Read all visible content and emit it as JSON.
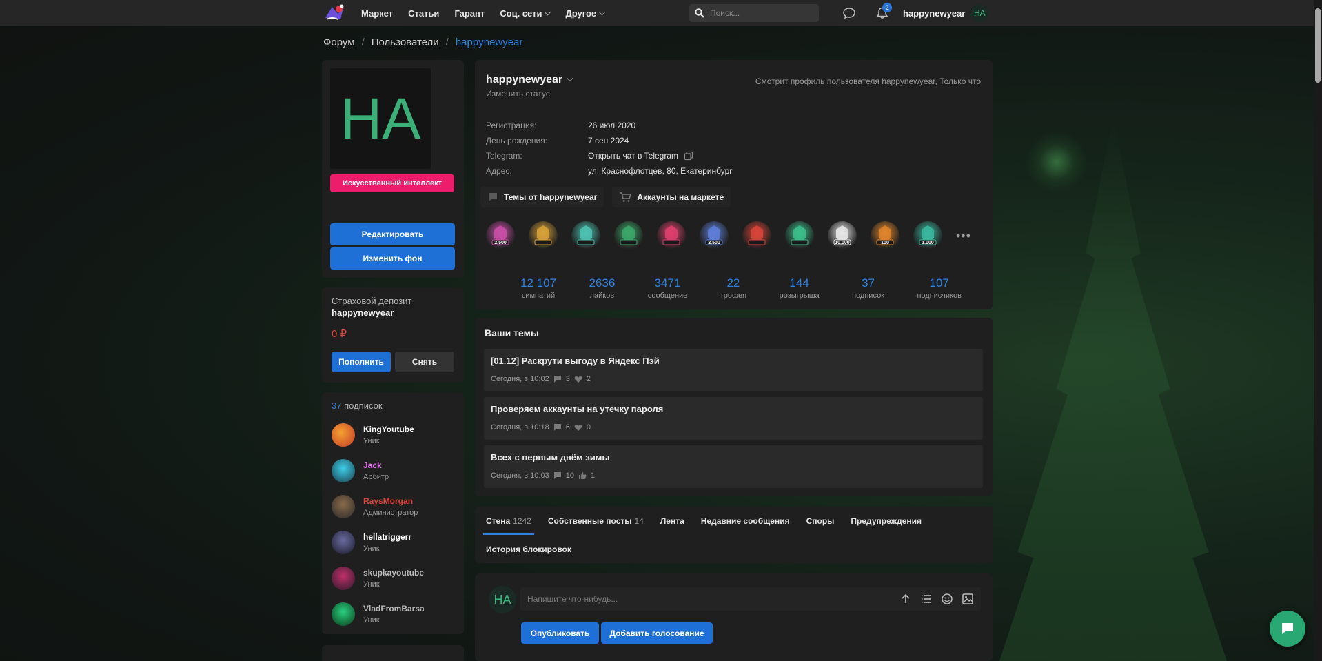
{
  "topbar": {
    "nav": [
      {
        "label": "Маркет",
        "dropdown": false
      },
      {
        "label": "Статьи",
        "dropdown": false
      },
      {
        "label": "Гарант",
        "dropdown": false
      },
      {
        "label": "Соц. сети",
        "dropdown": true
      },
      {
        "label": "Другое",
        "dropdown": true
      }
    ],
    "search_placeholder": "Поиск...",
    "notification_count": "2",
    "username": "happynewyear",
    "avatar_initials": "HA"
  },
  "breadcrumb": {
    "items": [
      "Форум",
      "Пользователи"
    ],
    "current": "happynewyear"
  },
  "profile_card": {
    "avatar_initials": "HA",
    "badge": "Искусственный интеллект",
    "edit_label": "Редактировать",
    "change_bg_label": "Изменить фон"
  },
  "deposit": {
    "title": "Страховой депозит",
    "username": "happynewyear",
    "amount": "0 ₽",
    "topup_label": "Пополнить",
    "withdraw_label": "Снять"
  },
  "subscriptions": {
    "count": "37",
    "label": "подписок",
    "items": [
      {
        "name": "KingYoutube",
        "role": "Уник",
        "color": "#ffffff",
        "strike": false
      },
      {
        "name": "Jack",
        "role": "Арбитр",
        "color": "#e277f0",
        "strike": false
      },
      {
        "name": "RaysMorgan",
        "role": "Администратор",
        "color": "#e0443a",
        "strike": false
      },
      {
        "name": "hellatriggerr",
        "role": "Уник",
        "color": "#ffffff",
        "strike": false
      },
      {
        "name": "skupkayoutube",
        "role": "Уник",
        "color": "#b8b8b8",
        "strike": true
      },
      {
        "name": "VladFromBarsa",
        "role": "Уник",
        "color": "#b8b8b8",
        "strike": true
      }
    ]
  },
  "profile": {
    "username": "happynewyear",
    "change_status": "Изменить статус",
    "viewing_note": "Смотрит профиль пользователя happynewyear, Только что",
    "info": [
      {
        "key": "Регистрация:",
        "value": "26 июл 2020"
      },
      {
        "key": "День рождения:",
        "value": "7 сен 2024"
      },
      {
        "key": "Telegram:",
        "value": "Открыть чат в Telegram"
      },
      {
        "key": "Адрес:",
        "value": "ул. Краснофлотцев, 80, Екатеринбург"
      }
    ],
    "topics_btn": "Темы от happynewyear",
    "market_btn": "Аккаунты на маркете",
    "trophies": [
      {
        "label": "2.500",
        "color": "#c94fa8"
      },
      {
        "label": "",
        "color": "#d8a23a"
      },
      {
        "label": "",
        "color": "#4fc3b3"
      },
      {
        "label": "",
        "color": "#3ca86a"
      },
      {
        "label": "",
        "color": "#e0406e"
      },
      {
        "label": "2.500",
        "color": "#5e7fd8"
      },
      {
        "label": "",
        "color": "#d8453a"
      },
      {
        "label": "",
        "color": "#3cbf8c"
      },
      {
        "label": "10.000",
        "color": "#e8e8e8"
      },
      {
        "label": "100",
        "color": "#e0862e"
      },
      {
        "label": "1.000",
        "color": "#3cb8a0"
      }
    ],
    "stats": [
      {
        "num": "12 107",
        "label": "симпатий"
      },
      {
        "num": "2636",
        "label": "лайков"
      },
      {
        "num": "3471",
        "label": "сообщение"
      },
      {
        "num": "22",
        "label": "трофея"
      },
      {
        "num": "144",
        "label": "розыгрыша"
      },
      {
        "num": "37",
        "label": "подписок"
      },
      {
        "num": "107",
        "label": "подписчиков"
      }
    ]
  },
  "threads": {
    "title": "Ваши темы",
    "items": [
      {
        "title": "[01.12] Раскрути выгоду в Яндекс Пэй",
        "date": "Сегодня, в 10:02",
        "replies": "3",
        "likes": "2",
        "like_type": "heart"
      },
      {
        "title": "Проверяем аккаунты на утечку пароля",
        "date": "Сегодня, в 10:18",
        "replies": "6",
        "likes": "0",
        "like_type": "heart"
      },
      {
        "title": "Всех с первым днём зимы",
        "date": "Сегодня, в 10:03",
        "replies": "10",
        "likes": "1",
        "like_type": "thumb"
      }
    ]
  },
  "wall_tabs": [
    {
      "label": "Стена",
      "count": "1242",
      "active": true
    },
    {
      "label": "Собственные посты",
      "count": "14",
      "active": false
    },
    {
      "label": "Лента",
      "count": "",
      "active": false
    },
    {
      "label": "Недавние сообщения",
      "count": "",
      "active": false
    },
    {
      "label": "Споры",
      "count": "",
      "active": false
    },
    {
      "label": "Предупреждения",
      "count": "",
      "active": false
    },
    {
      "label": "История блокировок",
      "count": "",
      "active": false
    }
  ],
  "composer": {
    "avatar_initials": "HA",
    "placeholder": "Напишите что-нибудь...",
    "publish_label": "Опубликовать",
    "poll_label": "Добавить голосование"
  }
}
